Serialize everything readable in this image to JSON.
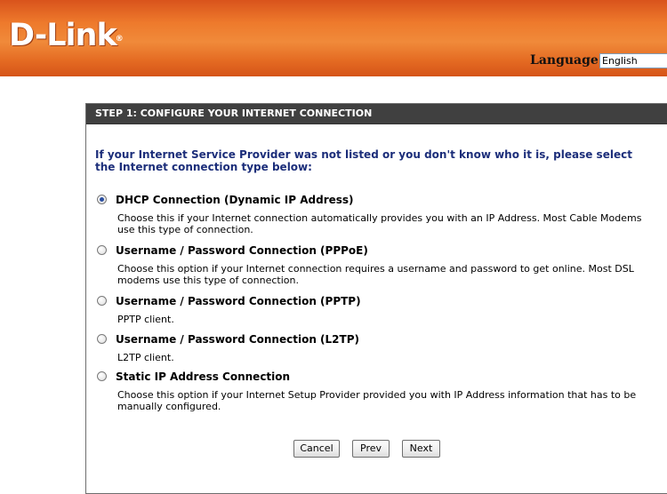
{
  "header": {
    "logo_text": "D-Link",
    "logo_reg": "®",
    "language_label": "Language :",
    "language_selected": "English"
  },
  "panel": {
    "title": "STEP 1: CONFIGURE YOUR INTERNET CONNECTION",
    "intro": "If your Internet Service Provider was not listed or you don't know who it is, please select the Internet connection type below:"
  },
  "options": [
    {
      "label": "DHCP Connection (Dynamic IP Address)",
      "description": "Choose this if your Internet connection automatically provides you with an IP Address. Most Cable Modems use this type of connection.",
      "checked": true
    },
    {
      "label": "Username / Password Connection (PPPoE)",
      "description": "Choose this option if your Internet connection requires a username and password to get online. Most DSL modems use this type of connection.",
      "checked": false
    },
    {
      "label": "Username / Password Connection (PPTP)",
      "description": "PPTP client.",
      "checked": false
    },
    {
      "label": "Username / Password Connection (L2TP)",
      "description": "L2TP client.",
      "checked": false
    },
    {
      "label": "Static IP Address Connection",
      "description": "Choose this option if your Internet Setup Provider provided you with IP Address information that has to be manually configured.",
      "checked": false
    }
  ],
  "buttons": {
    "cancel": "Cancel",
    "prev": "Prev",
    "next": "Next"
  },
  "colors": {
    "header_orange": "#ee7a2c",
    "title_bar": "#404040",
    "intro_text": "#1c2e7a"
  }
}
